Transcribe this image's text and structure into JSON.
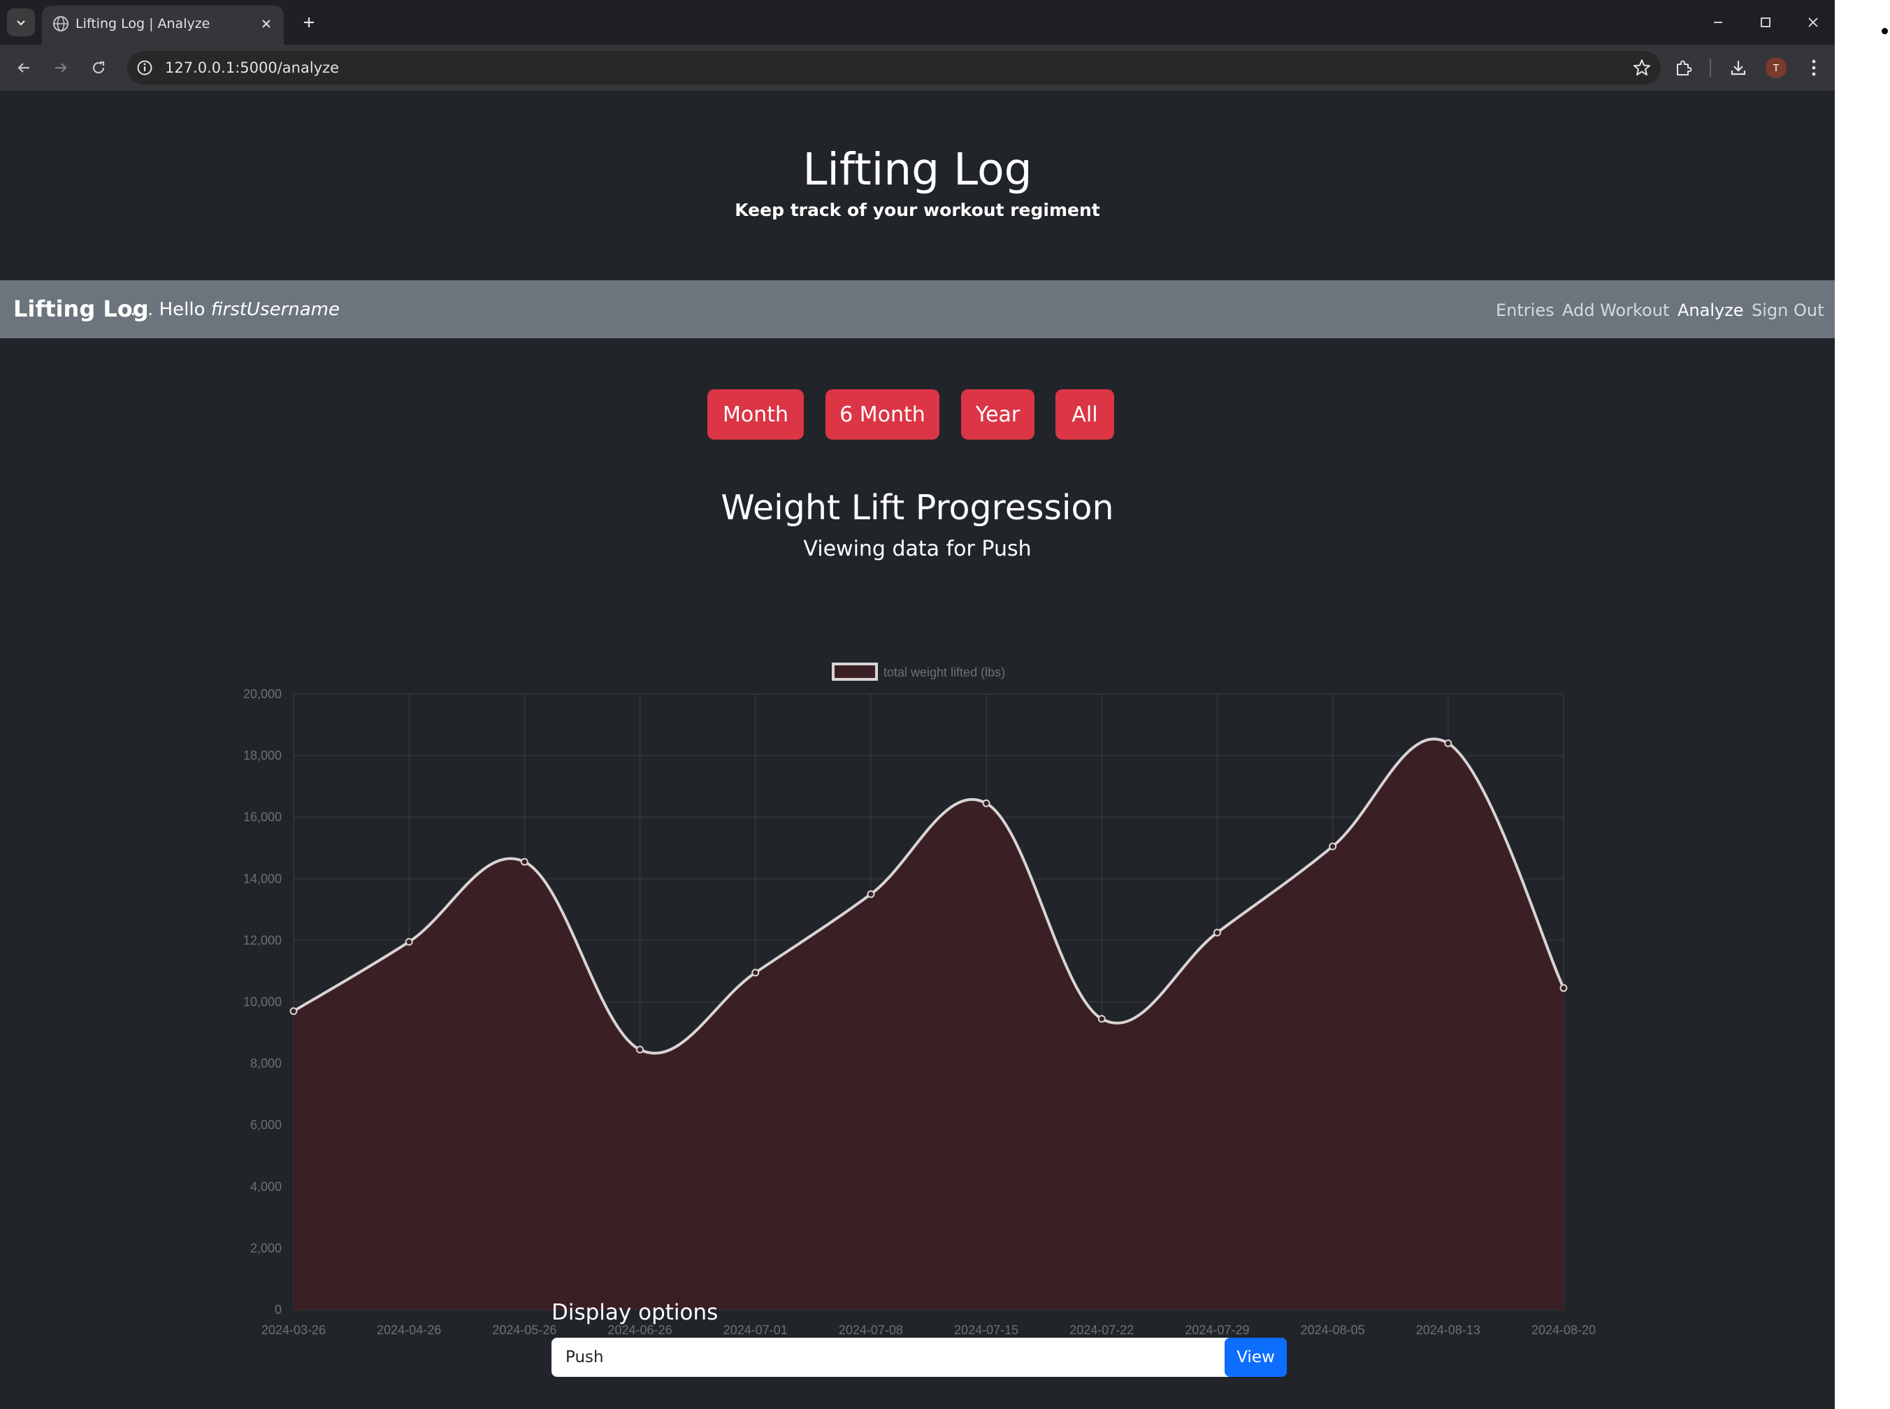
{
  "browser": {
    "tab": {
      "title": "Lifting Log | Analyze",
      "favicon": "globe-icon"
    },
    "url": "127.0.0.1:5000/analyze",
    "profile_initial": "T"
  },
  "header": {
    "title": "Lifting Log",
    "tagline": "Keep track of your workout regiment"
  },
  "navbar": {
    "brand": "Lifting Log",
    "greeting_prefix": "..... Hello ",
    "username": "firstUsername",
    "links": [
      {
        "label": "Entries",
        "active": false
      },
      {
        "label": "Add Workout",
        "active": false
      },
      {
        "label": "Analyze",
        "active": true
      },
      {
        "label": "Sign Out",
        "active": false
      }
    ]
  },
  "range_buttons": [
    "Month",
    "6 Month",
    "Year",
    "All"
  ],
  "display_options": {
    "label": "Display options",
    "selected": "Push",
    "view_label": "View"
  },
  "colors": {
    "page_bg": "#212529",
    "navbar_bg": "#6c757d",
    "range_button": "#dc3545",
    "view_button": "#0d6efd",
    "series_line": "#d9d4d4",
    "series_fill": "#3a2025"
  },
  "chart_data": {
    "type": "area",
    "title": "Weight Lift Progression",
    "subtitle": "Viewing data for Push",
    "x": [
      "2024-03-26",
      "2024-04-26",
      "2024-05-26",
      "2024-06-26",
      "2024-07-01",
      "2024-07-08",
      "2024-07-15",
      "2024-07-22",
      "2024-07-29",
      "2024-08-05",
      "2024-08-13",
      "2024-08-20"
    ],
    "series": [
      {
        "name": "total weight lifted (lbs)",
        "values": [
          9700,
          11950,
          14550,
          8450,
          10950,
          13500,
          16450,
          9450,
          12250,
          15050,
          18400,
          10450
        ]
      }
    ],
    "ylim": [
      0,
      20000
    ],
    "yticks": [
      "0",
      "2,000",
      "4,000",
      "6,000",
      "8,000",
      "10,000",
      "12,000",
      "14,000",
      "16,000",
      "18,000",
      "20,000"
    ],
    "grid": true,
    "legend": "top-center"
  }
}
